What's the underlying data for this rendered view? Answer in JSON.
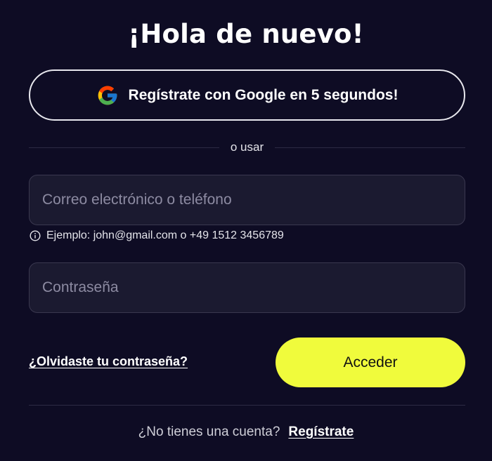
{
  "header": {
    "title": "¡Hola de nuevo!"
  },
  "google": {
    "label": "Regístrate con Google en 5 segundos!",
    "icon": "google-logo-icon"
  },
  "divider": {
    "text": "o usar"
  },
  "form": {
    "email_placeholder": "Correo electrónico o teléfono",
    "email_value": "",
    "hint_icon": "info-icon",
    "hint": "Ejemplo: john@gmail.com o +49 1512 3456789",
    "password_placeholder": "Contraseña",
    "password_value": ""
  },
  "actions": {
    "forgot": "¿Olvidaste tu contraseña?",
    "submit": "Acceder"
  },
  "footer": {
    "question": "¿No tienes una cuenta?",
    "signup": "Regístrate"
  },
  "colors": {
    "background": "#0e0c24",
    "accent": "#f0fb3c",
    "field_bg": "#1b1a30",
    "field_border": "#3a384f"
  }
}
